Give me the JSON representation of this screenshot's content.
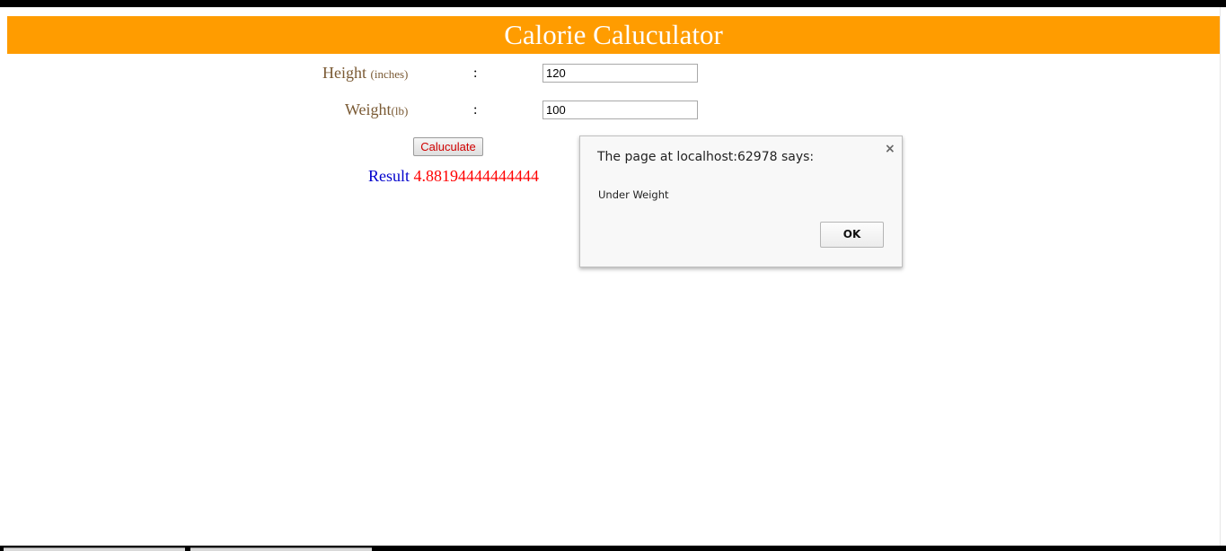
{
  "page": {
    "title": "Calorie Caluculator"
  },
  "form": {
    "height_label": "Height",
    "height_unit": "(inches)",
    "weight_label": "Weight",
    "weight_unit": "(lb)",
    "separator": ":",
    "height_value": "120",
    "weight_value": "100",
    "calculate_label": "Caluculate"
  },
  "result": {
    "label": "Result",
    "value": "4.88194444444444"
  },
  "dialog": {
    "title": "The page at localhost:62978 says:",
    "message": "Under Weight",
    "ok_label": "OK",
    "close_glyph": "×"
  },
  "colors": {
    "header_bg": "#ff9c00",
    "label_brown": "#7a5a34",
    "result_label": "#0000cc",
    "result_value": "#ff0000",
    "button_text": "#d00000"
  }
}
